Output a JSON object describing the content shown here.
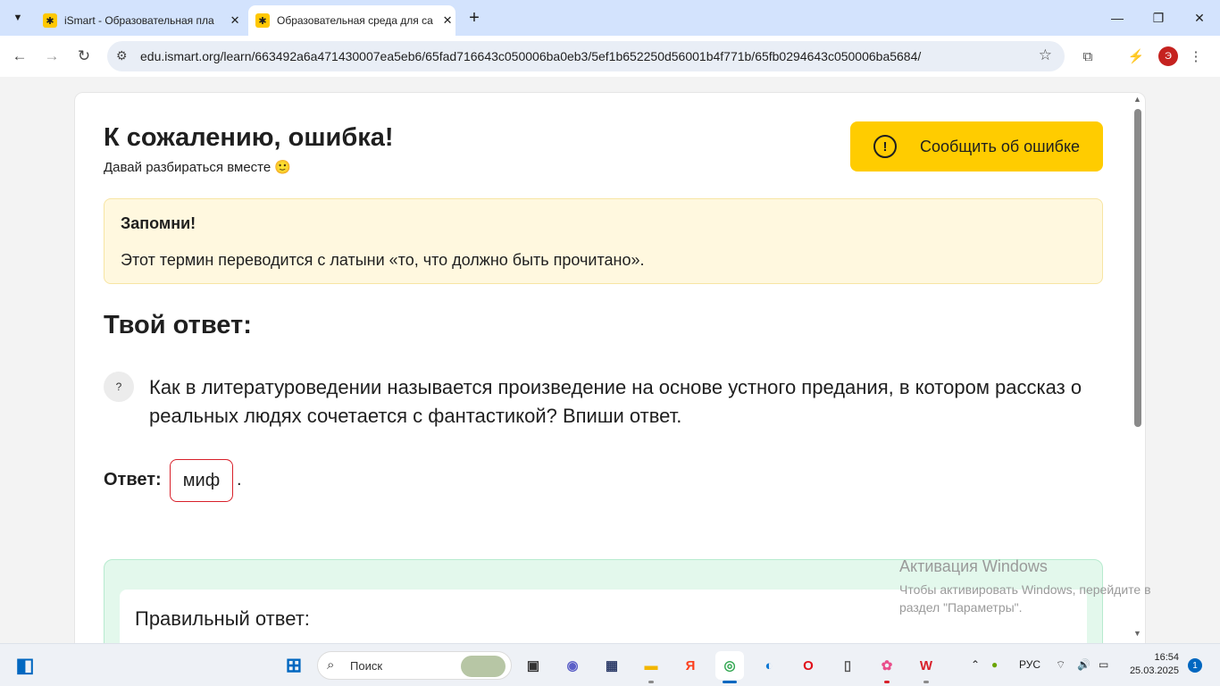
{
  "browser": {
    "tabs": [
      {
        "title": "iSmart - Образовательная пла",
        "favicon": "ismart-logo-icon"
      },
      {
        "title": "Образовательная среда для са",
        "favicon": "ismart-logo-icon"
      }
    ],
    "new_tab": "+",
    "url": "edu.ismart.org/learn/663492a6a471430007ea5eb6/65fad716643c050006ba0eb3/5ef1b652250d56001b4f771b/65fb0294643c050006ba5684/",
    "profile_initial": "Э"
  },
  "page": {
    "title": "К сожалению, ошибка!",
    "subtitle": "Давай разбираться вместе 🙂",
    "report_button": "Сообщить об ошибке",
    "remember": {
      "title": "Запомни!",
      "text": "Этот термин переводится с латыни «то, что должно быть прочитано»."
    },
    "your_answer_heading": "Твой ответ:",
    "question_badge": "?",
    "question": "Как в литературоведении называется произведение на основе устного предания, в котором рассказ о реальных людях сочетается с фантастикой? Впиши ответ.",
    "answer_label": "Ответ:",
    "answer_value": "миф",
    "answer_suffix": ".",
    "correct_heading": "Правильный ответ:"
  },
  "watermark": {
    "line1": "Активация Windows",
    "line2": "Чтобы активировать Windows, перейдите в раздел \"Параметры\"."
  },
  "taskbar": {
    "search_placeholder": "Поиск",
    "language": "РУС",
    "time": "16:54",
    "date": "25.03.2025",
    "notifications": "1"
  },
  "colors": {
    "accent_yellow": "#ffcc00",
    "remember_bg": "#fff8df",
    "error_red": "#d8202a",
    "correct_bg": "#e3f8ec"
  }
}
